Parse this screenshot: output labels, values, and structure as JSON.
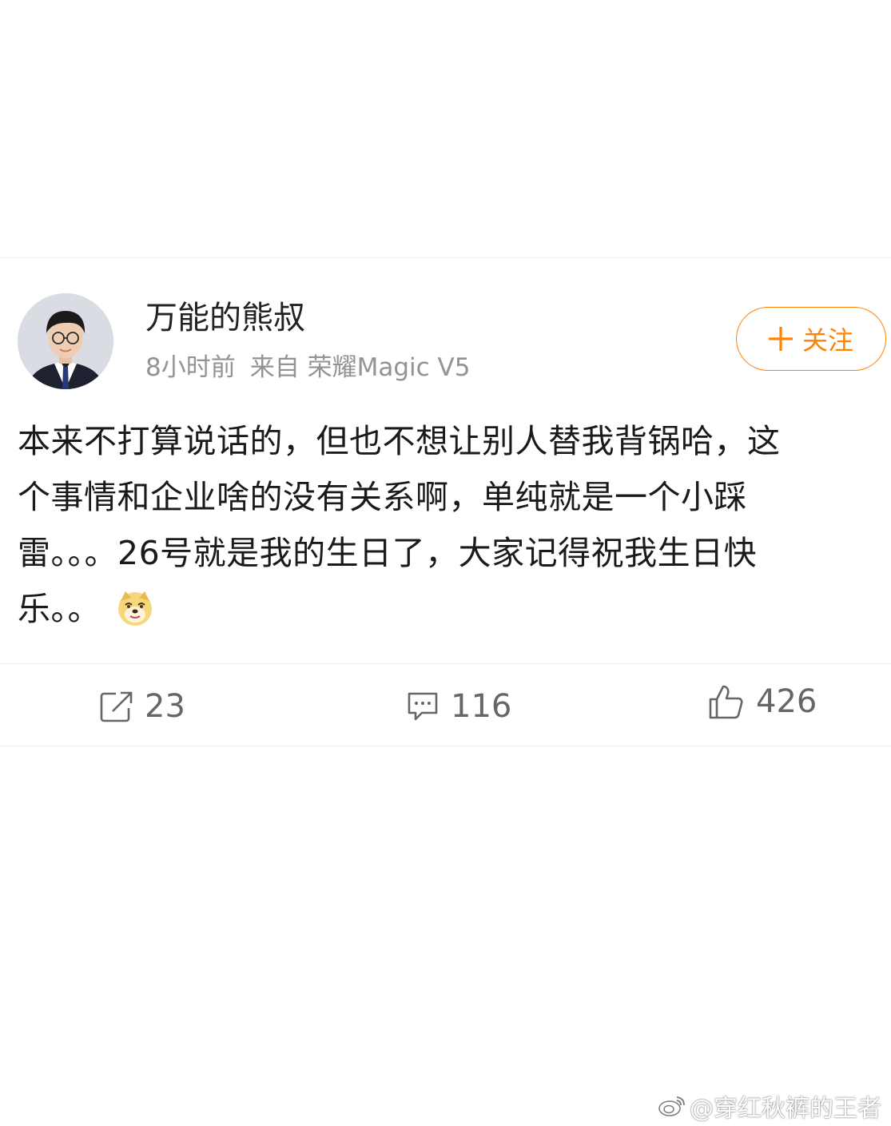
{
  "post": {
    "author_name": "万能的熊叔",
    "time": "8小时前",
    "source": "来自 荣耀Magic V5",
    "follow_label": "关注",
    "text_lines": [
      "本来不打算说话的，但也不想让别人替我背锅哈，这",
      "个事情和企业啥的没有关系啊，单纯就是一个小踩",
      "雷。。。26号就是我的生日了，大家记得祝我生日快",
      "乐。。"
    ],
    "emoji": "doge-emoji-icon"
  },
  "actions": {
    "repost_count": "23",
    "comment_count": "116",
    "like_count": "426"
  },
  "watermark": {
    "text": "@穿红秋裤的王者"
  },
  "colors": {
    "accent": "#ff8200",
    "meta": "#939393",
    "icon": "#666666"
  }
}
